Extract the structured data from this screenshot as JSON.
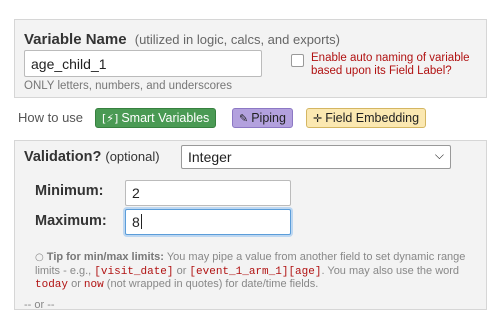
{
  "variable": {
    "heading": "Variable Name",
    "heading_hint": "(utilized in logic, calcs, and exports)",
    "value": "age_child_1",
    "note": "ONLY letters, numbers, and underscores",
    "auto_naming_label": "Enable auto naming of variable based upon its Field Label?"
  },
  "how_to": {
    "label": "How to use",
    "smart_variables": "Smart Variables",
    "smart_icon": "[⚡]",
    "piping": "Piping",
    "piping_icon": "✎",
    "field_embedding": "Field Embedding",
    "field_embedding_icon": "✛"
  },
  "validation": {
    "label": "Validation?",
    "optional": "(optional)",
    "selected": "Integer",
    "min_label": "Minimum:",
    "min_value": "2",
    "max_label": "Maximum:",
    "max_value": "8"
  },
  "tip": {
    "title": "Tip for min/max limits:",
    "text1": "You may pipe a value from another field to set dynamic range limits - e.g.,",
    "code1": "[visit_date]",
    "or": "or",
    "code2": "[event_1_arm_1][age]",
    "text2": ". You may also use the word",
    "code3": "today",
    "or2": "or",
    "code4": "now",
    "text3": "(not wrapped in quotes) for date/time fields."
  },
  "footer": {
    "or_text": "-- or --"
  },
  "colors": {
    "red_text": "#b11212",
    "smart_green": "#4a9a54",
    "piping_purple": "#b3a1de",
    "embed_yellow": "#fbe8b1"
  }
}
